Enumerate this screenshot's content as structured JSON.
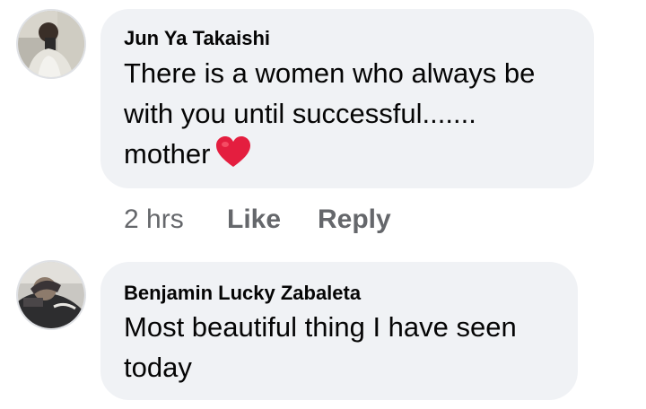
{
  "comments": [
    {
      "author": "Jun Ya Takaishi",
      "lines": [
        "There is a women who always be",
        "with you until successful.......",
        "mother"
      ],
      "emoji": "heart-emoji",
      "time": "2 hrs",
      "like_label": "Like",
      "reply_label": "Reply"
    },
    {
      "author": "Benjamin Lucky Zabaleta",
      "lines": [
        "Most beautiful thing I have seen",
        "today"
      ]
    }
  ],
  "colors": {
    "bubble": "#f0f2f5",
    "text": "#050505",
    "meta": "#65676b",
    "heart": "#e41e3f"
  }
}
